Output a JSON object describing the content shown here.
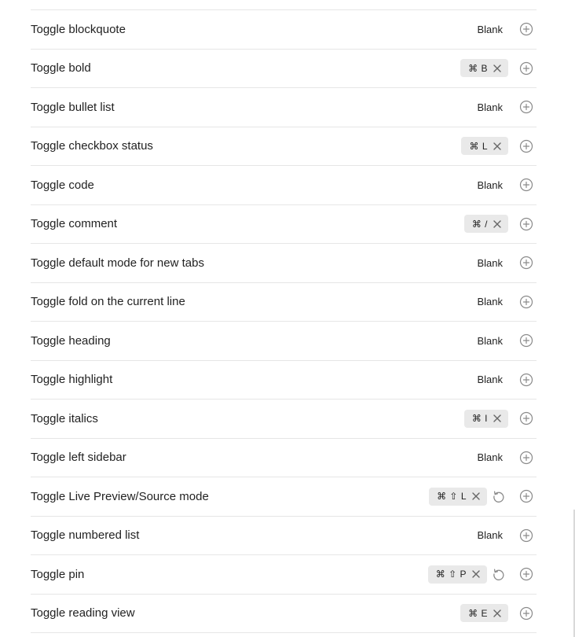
{
  "hotkeys": [
    {
      "label": "Toggle blockquote",
      "blank": "Blank"
    },
    {
      "label": "Toggle bold",
      "keys": "⌘ B"
    },
    {
      "label": "Toggle bullet list",
      "blank": "Blank"
    },
    {
      "label": "Toggle checkbox status",
      "keys": "⌘ L"
    },
    {
      "label": "Toggle code",
      "blank": "Blank"
    },
    {
      "label": "Toggle comment",
      "keys": "⌘ /"
    },
    {
      "label": "Toggle default mode for new tabs",
      "blank": "Blank"
    },
    {
      "label": "Toggle fold on the current line",
      "blank": "Blank"
    },
    {
      "label": "Toggle heading",
      "blank": "Blank"
    },
    {
      "label": "Toggle highlight",
      "blank": "Blank"
    },
    {
      "label": "Toggle italics",
      "keys": "⌘ I"
    },
    {
      "label": "Toggle left sidebar",
      "blank": "Blank"
    },
    {
      "label": "Toggle Live Preview/Source mode",
      "keys": "⌘ ⇧ L",
      "restore": true
    },
    {
      "label": "Toggle numbered list",
      "blank": "Blank"
    },
    {
      "label": "Toggle pin",
      "keys": "⌘ ⇧ P",
      "restore": true
    },
    {
      "label": "Toggle reading view",
      "keys": "⌘ E"
    }
  ],
  "icons": {
    "remove": "close-icon",
    "restore": "restore-default-icon",
    "add": "add-hotkey-icon"
  },
  "colors": {
    "hotkey_bg": "#e9e9e9",
    "icon": "#8a8a8a",
    "divider": "#e6e6e6"
  }
}
